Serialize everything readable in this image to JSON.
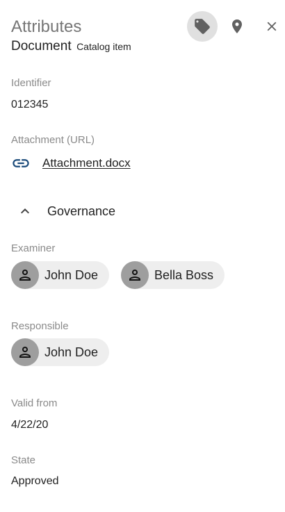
{
  "header": {
    "title": "Attributes",
    "type": "Document",
    "kind": "Catalog item"
  },
  "toolbar": {
    "tag_icon": "tag-icon",
    "location_icon": "location-pin-icon",
    "close_icon": "close-icon"
  },
  "fields": {
    "identifier": {
      "label": "Identifier",
      "value": "012345"
    },
    "attachment": {
      "label": "Attachment (URL)",
      "link_text": "Attachment.docx",
      "icon": "link-icon"
    }
  },
  "governance": {
    "title": "Governance",
    "examiner": {
      "label": "Examiner",
      "people": [
        "John Doe",
        "Bella Boss"
      ]
    },
    "responsible": {
      "label": "Responsible",
      "people": [
        "John Doe"
      ]
    }
  },
  "valid_from": {
    "label": "Valid from",
    "value": "4/22/20"
  },
  "state": {
    "label": "State",
    "value": "Approved"
  },
  "colors": {
    "active_button_bg": "#e0e0e0",
    "avatar_bg": "#9e9e9e",
    "chip_bg": "#eeeeee",
    "link_icon": "#1a4a7a"
  }
}
